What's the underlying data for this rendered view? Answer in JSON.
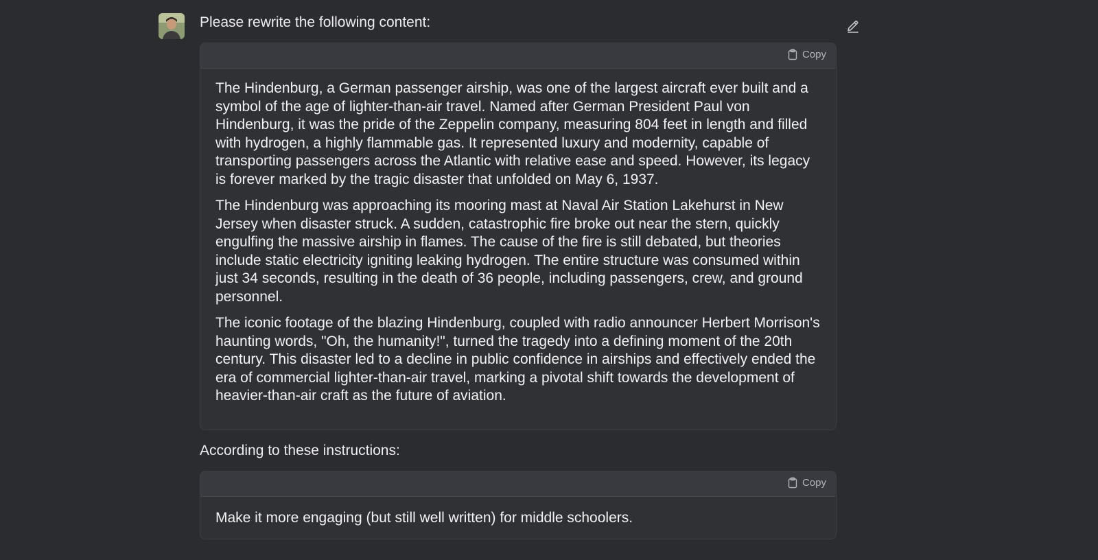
{
  "message": {
    "intro": "Please rewrite the following content:",
    "content_block": {
      "copy_label": "Copy",
      "paragraphs": [
        "The Hindenburg, a German passenger airship, was one of the largest aircraft ever built and a symbol of the age of lighter-than-air travel. Named after German President Paul von Hindenburg, it was the pride of the Zeppelin company, measuring 804 feet in length and filled with hydrogen, a highly flammable gas. It represented luxury and modernity, capable of transporting passengers across the Atlantic with relative ease and speed. However, its legacy is forever marked by the tragic disaster that unfolded on May 6, 1937.",
        "The Hindenburg was approaching its mooring mast at Naval Air Station Lakehurst in New Jersey when disaster struck. A sudden, catastrophic fire broke out near the stern, quickly engulfing the massive airship in flames. The cause of the fire is still debated, but theories include static electricity igniting leaking hydrogen. The entire structure was consumed within just 34 seconds, resulting in the death of 36 people, including passengers, crew, and ground personnel.",
        "The iconic footage of the blazing Hindenburg, coupled with radio announcer Herbert Morrison's haunting words, \"Oh, the humanity!\", turned the tragedy into a defining moment of the 20th century. This disaster led to a decline in public confidence in airships and effectively ended the era of commercial lighter-than-air travel, marking a pivotal shift towards the development of heavier-than-air craft as the future of aviation."
      ]
    },
    "instructions_intro": "According to these instructions:",
    "instructions_block": {
      "copy_label": "Copy",
      "text": "Make it more engaging (but still well written) for middle schoolers."
    }
  },
  "icons": {
    "avatar": "user-avatar",
    "edit": "pencil-icon",
    "copy": "clipboard-icon"
  },
  "colors": {
    "background": "#2b2c2f",
    "block_background": "#303135",
    "block_header": "#393a3f",
    "text": "#ececf1",
    "muted": "#b4b4bb"
  }
}
